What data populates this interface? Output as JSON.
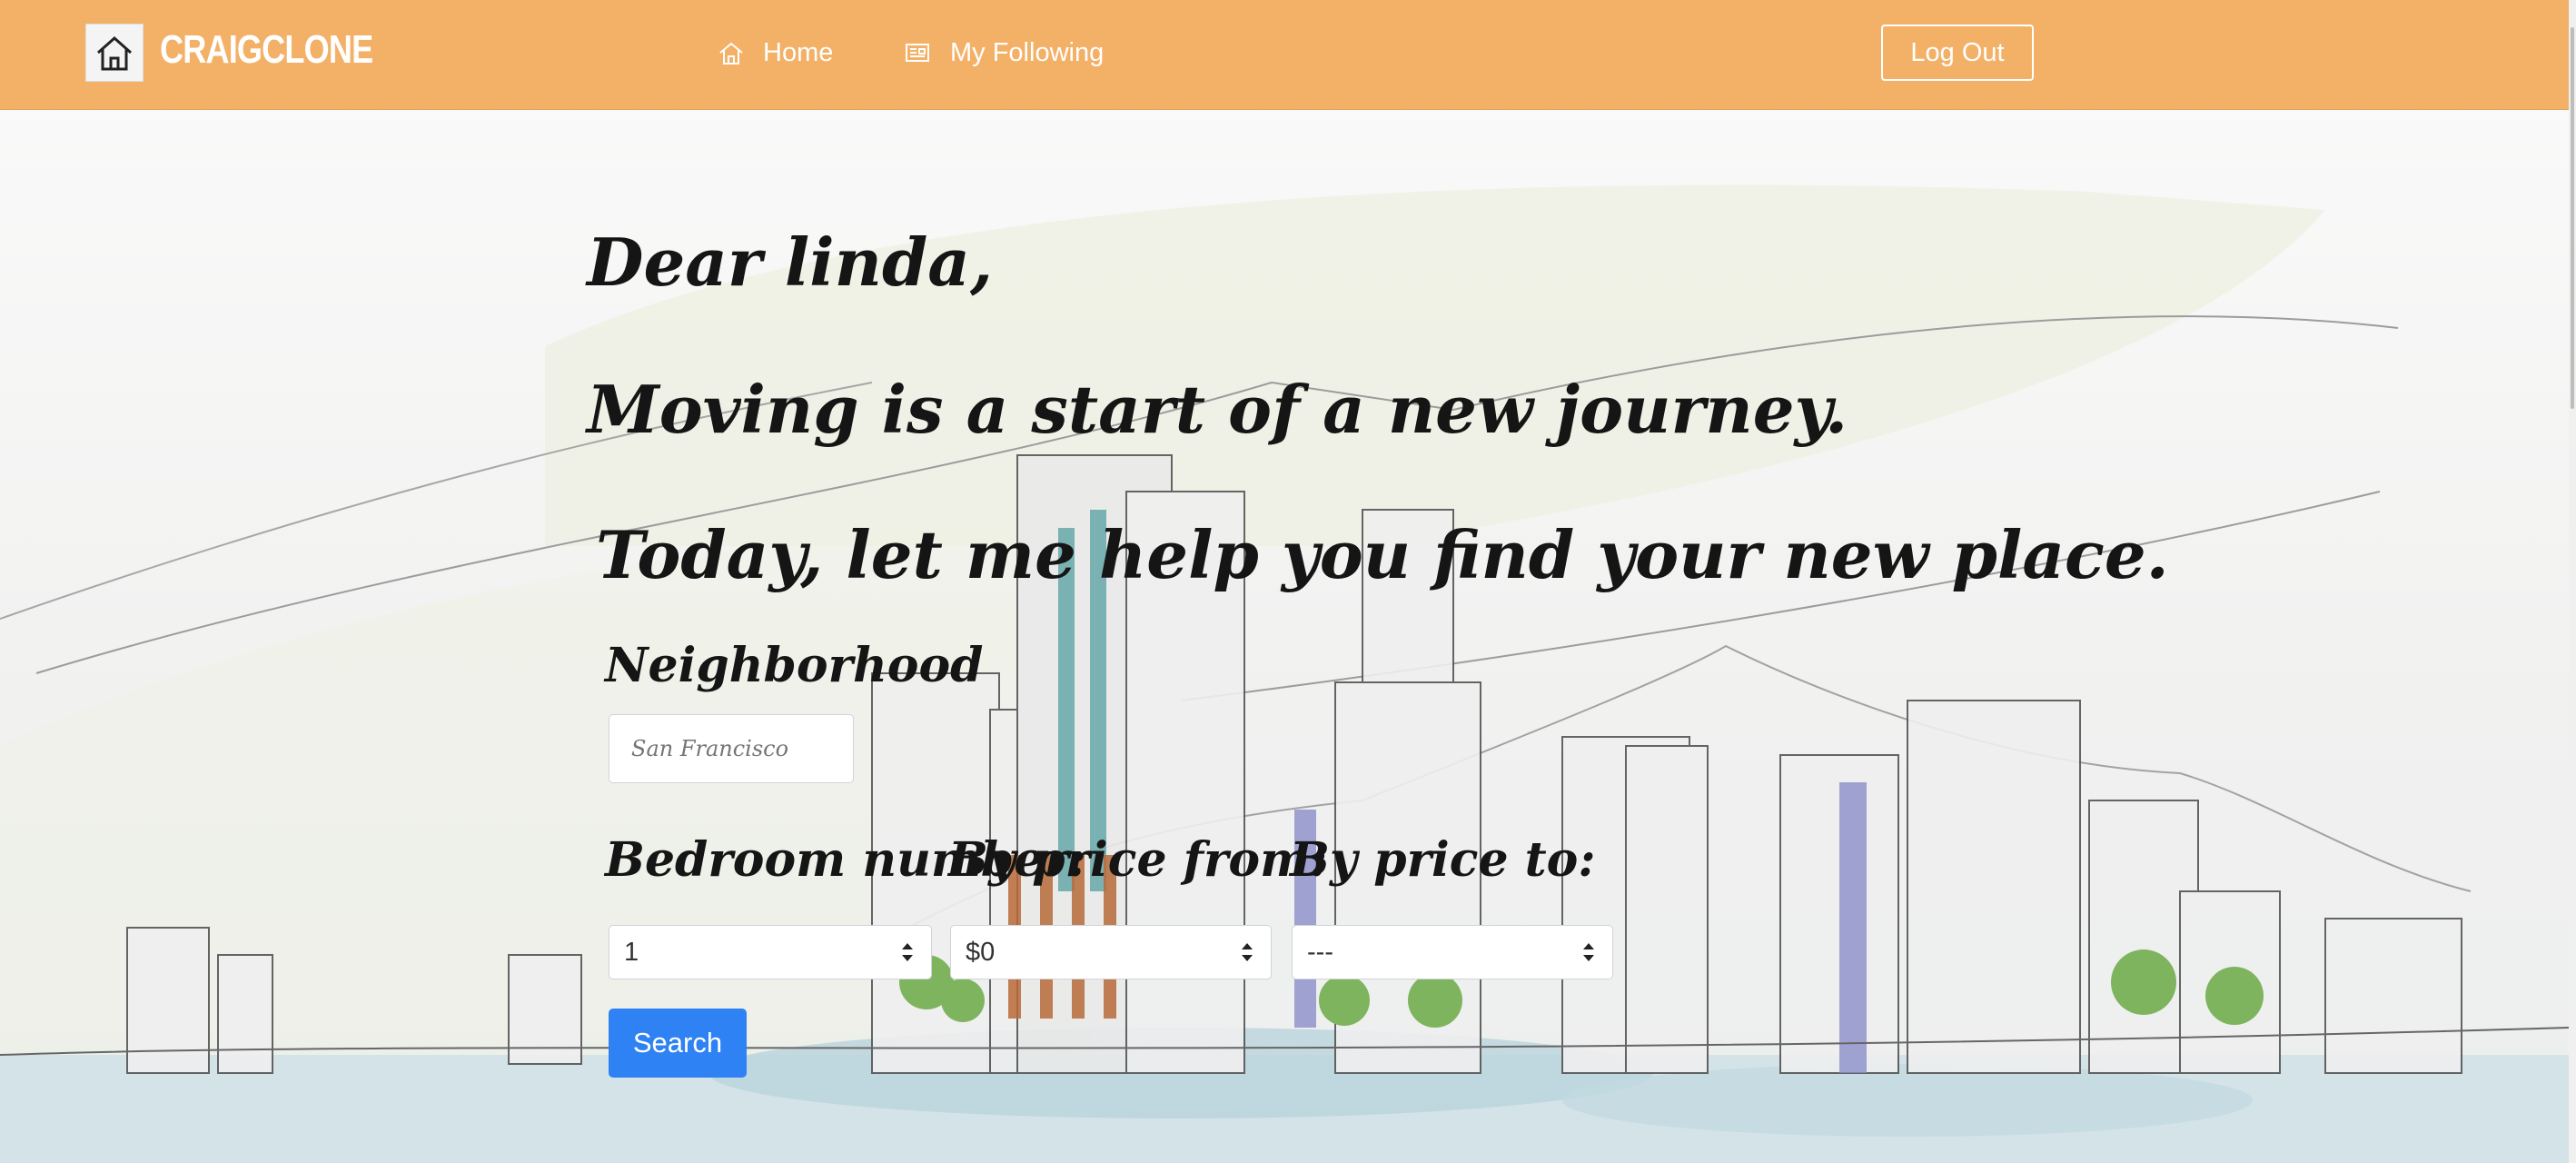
{
  "brand": {
    "name": "CRAIGCLONE",
    "icon": "house-icon"
  },
  "nav": {
    "home_label": "Home",
    "following_label": "My Following",
    "logout_label": "Log Out"
  },
  "greeting": {
    "line1": "Dear linda,",
    "line2": "Moving is a start of a new journey.",
    "line3": "Today, let me help you find your new place."
  },
  "form": {
    "neighborhood_label": "Neighborhood",
    "neighborhood_placeholder": "San Francisco",
    "bedroom_label": "Bedroom number:",
    "bedroom_value": "1",
    "price_from_label": "By price from:",
    "price_from_value": "$0",
    "price_to_label": "By price to:",
    "price_to_value": "---",
    "search_label": "Search"
  },
  "colors": {
    "navbar": "#f3b168",
    "primary_button": "#2f82f3"
  }
}
